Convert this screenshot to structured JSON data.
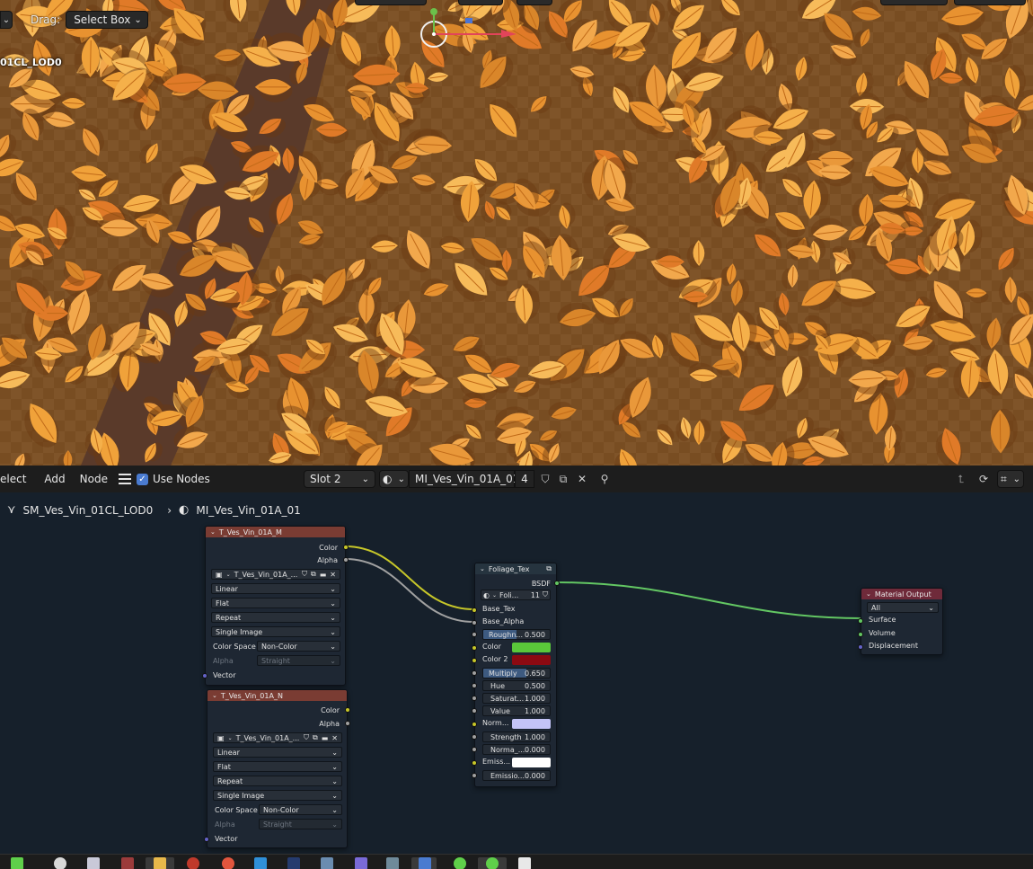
{
  "viewport": {
    "drag_label": "Drag:",
    "drag_mode": "Select Box",
    "object_name": "01CL_LOD0"
  },
  "node_editor_header": {
    "select": "elect",
    "add": "Add",
    "node": "Node",
    "use_nodes": "Use Nodes",
    "slot": "Slot 2",
    "material": "MI_Ves_Vin_01A_01",
    "users": "4"
  },
  "breadcrumb": {
    "mesh": "SM_Ves_Vin_01CL_LOD0",
    "material": "MI_Ves_Vin_01A_01"
  },
  "tex_m": {
    "title": "T_Ves_Vin_01A_M",
    "out_color": "Color",
    "out_alpha": "Alpha",
    "image": "T_Ves_Vin_01A_...",
    "interpolation": "Linear",
    "projection": "Flat",
    "extension": "Repeat",
    "source": "Single Image",
    "color_space_label": "Color Space",
    "color_space": "Non-Color",
    "alpha_label": "Alpha",
    "alpha_mode": "Straight",
    "in_vector": "Vector"
  },
  "tex_n": {
    "title": "T_Ves_Vin_01A_N",
    "out_color": "Color",
    "out_alpha": "Alpha",
    "image": "T_Ves_Vin_01A_...",
    "interpolation": "Linear",
    "projection": "Flat",
    "extension": "Repeat",
    "source": "Single Image",
    "color_space_label": "Color Space",
    "color_space": "Non-Color",
    "alpha_label": "Alpha",
    "alpha_mode": "Straight",
    "in_vector": "Vector"
  },
  "foliage": {
    "title": "Foliage_Tex",
    "out_bsdf": "BSDF",
    "group_name": "Foli...",
    "group_users": "11",
    "base_tex": "Base_Tex",
    "base_alpha": "Base_Alpha",
    "roughness_label": "Roughn...",
    "roughness": "0.500",
    "roughness_fraction": 0.5,
    "color_label": "Color",
    "color_value": "#5ac83a",
    "color2_label": "Color 2",
    "color2_value": "#8c0a12",
    "multiply_label": "Multiply",
    "multiply": "0.650",
    "multiply_fraction": 0.65,
    "hue_label": "Hue",
    "hue": "0.500",
    "saturation_label": "Saturat...",
    "saturation": "1.000",
    "value_label": "Value",
    "value": "1.000",
    "normal_label": "Norm...",
    "normal_value": "#c4c4f7",
    "strength_label": "Strength",
    "strength": "1.000",
    "normal_amt_label": "Norma_...",
    "normal_amt": "0.000",
    "emission_label": "Emiss...",
    "emission_value": "#ffffff",
    "emission_str_label": "Emissio...",
    "emission_str": "0.000"
  },
  "output": {
    "title": "Material Output",
    "target": "All",
    "surface": "Surface",
    "volume": "Volume",
    "displacement": "Displacement"
  },
  "colors": {
    "link_yellow": "#c7c729",
    "link_grey": "#a1a1a1",
    "link_green": "#63c763",
    "accent_blue": "#4a7bd0"
  }
}
